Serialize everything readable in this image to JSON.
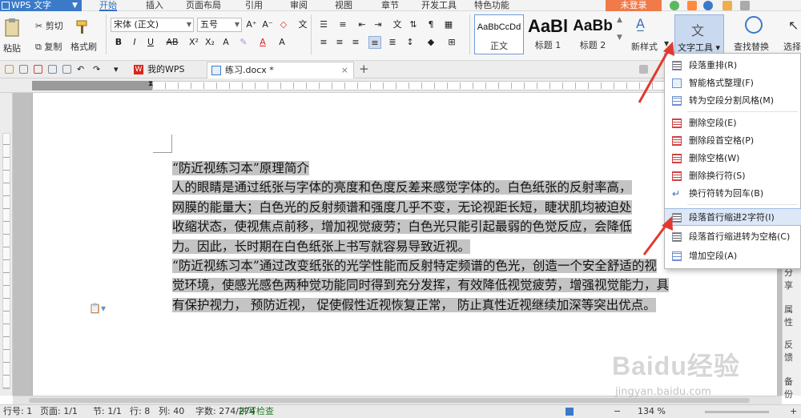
{
  "menubar": {
    "app_name": "WPS 文字",
    "tabs": [
      "开始",
      "插入",
      "页面布局",
      "引用",
      "审阅",
      "视图",
      "章节",
      "开发工具",
      "特色功能"
    ],
    "login": "未登录"
  },
  "ribbon": {
    "cut": "剪切",
    "copy": "复制",
    "format_painter": "格式刷",
    "paste": "粘贴",
    "font_name": "宋体 (正文)",
    "font_size": "五号",
    "styles": [
      {
        "preview": "AaBbCcDd",
        "label": "正文"
      },
      {
        "preview": "AaBl",
        "label": "标题 1"
      },
      {
        "preview": "AaBb",
        "label": "标题 2"
      }
    ],
    "new_style": "新样式",
    "text_tool": "文字工具",
    "find_replace": "查找替换",
    "select": "选择"
  },
  "tabbar": {
    "tabs": [
      {
        "label": "我的WPS"
      },
      {
        "label": "练习.docx *"
      }
    ],
    "add": "+"
  },
  "document": {
    "lines": [
      "“防近视练习本”原理简介",
      "人的眼睛是通过纸张与字体的亮度和色度反差来感觉字体的。白色纸张的反射率高，",
      "网膜的能量大；白色光的反射频谱和强度几乎不变，无论视距长短，睫状肌均被迫处",
      "收缩状态，使视焦点前移，增加视觉疲劳；白色光只能引起最弱的色觉反应，会降低",
      "力。因此，长时期在白色纸张上书写就容易导致近视。",
      "“防近视练习本”通过改变纸张的光学性能而反射特定频谱的色光，创造一个安全舒适的视",
      "觉环境，使感光感色两种觉功能同时得到充分发挥，有效降低视觉疲劳，增强视觉能力，具",
      "有保护视力， 预防近视， 促使假性近视恢复正常， 防止真性近视继续加深等突出优点。"
    ]
  },
  "dropdown": {
    "items": [
      {
        "label": "段落重排(R)",
        "icon": "paragraph-rearrange-icon"
      },
      {
        "label": "智能格式整理(F)",
        "icon": "smart-format-icon"
      },
      {
        "label": "转为空段分割风格(M)",
        "icon": "empty-paragraph-split-icon"
      },
      {
        "label": "删除空段(E)",
        "icon": "delete-empty-paragraph-icon"
      },
      {
        "label": "删除段首空格(P)",
        "icon": "delete-leading-space-icon"
      },
      {
        "label": "删除空格(W)",
        "icon": "delete-space-icon"
      },
      {
        "label": "删除换行符(S)",
        "icon": "delete-linebreak-icon"
      },
      {
        "label": "换行符转为回车(B)",
        "icon": "linebreak-to-enter-icon"
      },
      {
        "label": "段落首行缩进2字符(I)",
        "icon": "first-line-indent-icon"
      },
      {
        "label": "段落首行缩进转为空格(C)",
        "icon": "indent-to-space-icon"
      },
      {
        "label": "增加空段(A)",
        "icon": "add-empty-paragraph-icon"
      }
    ]
  },
  "sidebar": {
    "items": [
      "分享",
      "属性",
      "反馈",
      "备份"
    ]
  },
  "statusbar": {
    "row": "行号: 1",
    "page": "页面: 1/1",
    "section": "节: 1/1",
    "line": "行: 8",
    "col": "列: 40",
    "words": "字数: 274/274",
    "spell": "拼写检查",
    "zoom": "134 %"
  },
  "watermark": {
    "text": "Baidu经验",
    "url": "jingyan.baidu.com"
  },
  "colors": {
    "accent": "#2f6fc1",
    "login": "#f07a4a",
    "highlight": "#c4c4c4",
    "arrow": "#e03a2e"
  }
}
